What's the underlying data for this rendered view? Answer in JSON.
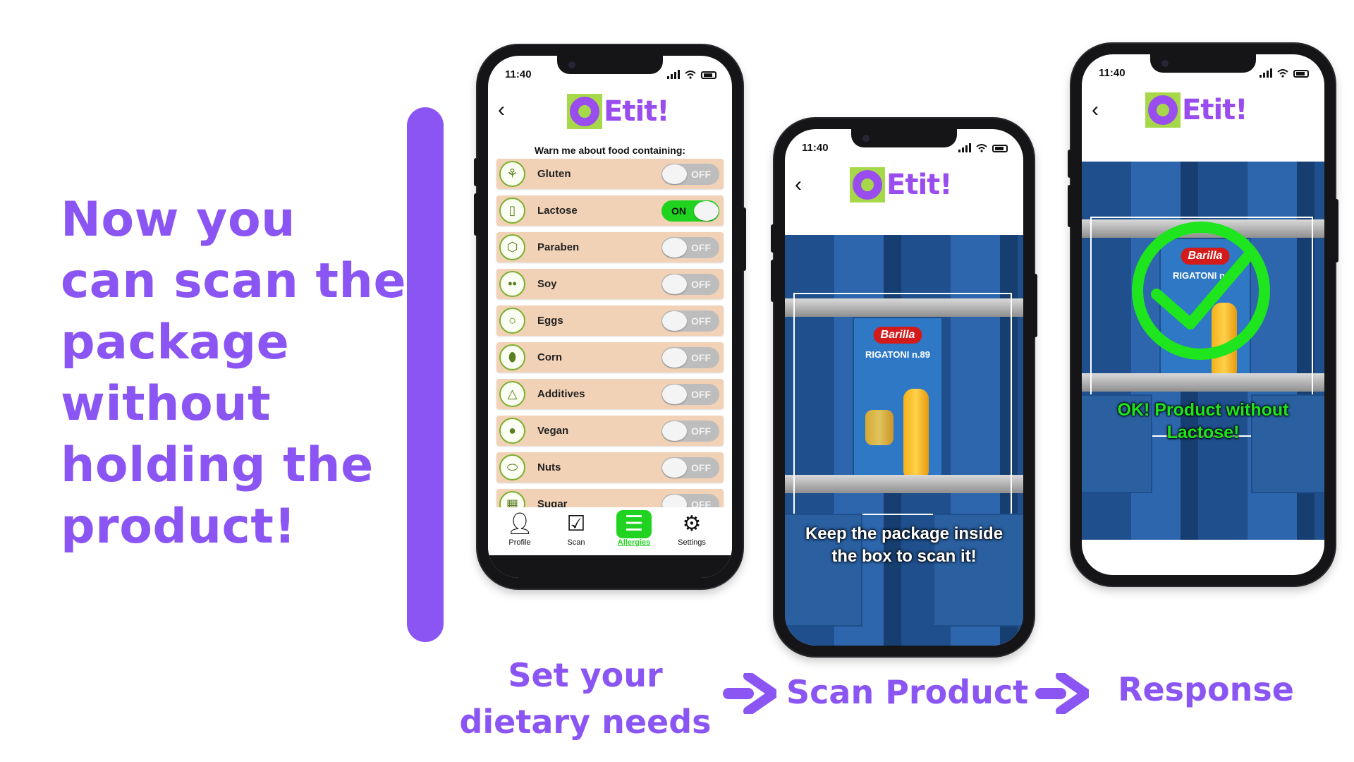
{
  "headline": [
    "Now you",
    "can scan the",
    "package",
    "without",
    "holding the",
    "product!"
  ],
  "colors": {
    "accent": "#8a55f2",
    "brand_purple": "#9a4dee",
    "brand_green": "#a7d84a",
    "toggle_on": "#21d321",
    "row_bg": "#f2d2b6"
  },
  "status": {
    "time": "11:40"
  },
  "app": {
    "logo_text": "Etit!",
    "back_icon": "chevron-left-icon"
  },
  "allergies": {
    "heading": "Warn me about food containing:",
    "items": [
      {
        "name": "Gluten",
        "icon": "wheat-icon",
        "state": "OFF"
      },
      {
        "name": "Lactose",
        "icon": "milk-bottle-icon",
        "state": "ON"
      },
      {
        "name": "Paraben",
        "icon": "paraben-icon",
        "state": "OFF"
      },
      {
        "name": "Soy",
        "icon": "soy-icon",
        "state": "OFF"
      },
      {
        "name": "Eggs",
        "icon": "egg-icon",
        "state": "OFF"
      },
      {
        "name": "Corn",
        "icon": "corn-icon",
        "state": "OFF"
      },
      {
        "name": "Additives",
        "icon": "flask-icon",
        "state": "OFF"
      },
      {
        "name": "Vegan",
        "icon": "apple-icon",
        "state": "OFF"
      },
      {
        "name": "Nuts",
        "icon": "peanut-icon",
        "state": "OFF"
      },
      {
        "name": "Sugar",
        "icon": "sugar-cube-icon",
        "state": "OFF"
      }
    ]
  },
  "tabs": [
    {
      "label": "Profile",
      "icon": "person-icon"
    },
    {
      "label": "Scan",
      "icon": "scan-icon"
    },
    {
      "label": "Allergies",
      "icon": "toggles-icon",
      "active": true
    },
    {
      "label": "Settings",
      "icon": "gear-icon"
    }
  ],
  "scan": {
    "instruction": "Keep the package inside the box to scan it!",
    "brand": "Barilla",
    "product": "RIGATONI n.89"
  },
  "response": {
    "message": "OK! Product without Lactose!",
    "icon": "checkmark-circle-icon"
  },
  "captions": {
    "step1": "Set your\ndietary needs",
    "step2": "Scan Product",
    "step3": "Response"
  }
}
